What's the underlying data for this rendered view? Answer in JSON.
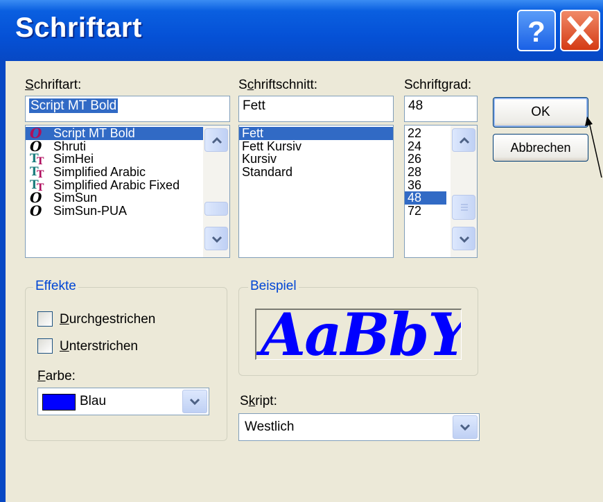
{
  "window": {
    "title": "Schriftart"
  },
  "font_section": {
    "label_prefix": "",
    "label_ul": "S",
    "label_rest": "chriftart:",
    "value": "Script MT Bold",
    "items": [
      {
        "label": "Script MT Bold",
        "icon": "opentype-icon",
        "selected": true
      },
      {
        "label": "Shruti",
        "icon": "opentype-icon"
      },
      {
        "label": "SimHei",
        "icon": "truetype-icon"
      },
      {
        "label": "Simplified Arabic",
        "icon": "truetype-icon"
      },
      {
        "label": "Simplified Arabic Fixed",
        "icon": "truetype-icon"
      },
      {
        "label": "SimSun",
        "icon": "opentype-icon"
      },
      {
        "label": "SimSun-PUA",
        "icon": "opentype-icon"
      }
    ]
  },
  "style_section": {
    "label_prefix": "S",
    "label_ul": "c",
    "label_rest": "hriftschnitt:",
    "value": "Fett",
    "items": [
      {
        "label": "Fett",
        "selected": true
      },
      {
        "label": "Fett Kursiv"
      },
      {
        "label": "Kursiv"
      },
      {
        "label": "Standard"
      }
    ]
  },
  "size_section": {
    "label_prefix": "Schrift",
    "label_ul": "g",
    "label_rest": "rad:",
    "value": "48",
    "items": [
      {
        "label": "22"
      },
      {
        "label": "24"
      },
      {
        "label": "26"
      },
      {
        "label": "28"
      },
      {
        "label": "36"
      },
      {
        "label": "48",
        "selected": true
      },
      {
        "label": "72"
      }
    ]
  },
  "buttons": {
    "ok": "OK",
    "cancel": "Abbrechen"
  },
  "effects": {
    "legend": "Effekte",
    "strike_ul": "D",
    "strike_rest": "urchgestrichen",
    "strike_checked": false,
    "underline_ul": "U",
    "underline_rest": "nterstrichen",
    "underline_checked": false,
    "color_label_ul": "F",
    "color_label_rest": "arbe:",
    "color_value": "Blau",
    "color_swatch": "#0000ff"
  },
  "sample": {
    "legend": "Beispiel",
    "text": "AaBbYyZz",
    "color": "#0000ff"
  },
  "script": {
    "label_prefix": "S",
    "label_ul": "k",
    "label_rest": "ript:",
    "value": "Westlich"
  },
  "colors": {
    "titlebar": "#0551d6",
    "selection": "#316ac5",
    "dialog_bg": "#ece9d8",
    "legend_text": "#0046d5"
  }
}
